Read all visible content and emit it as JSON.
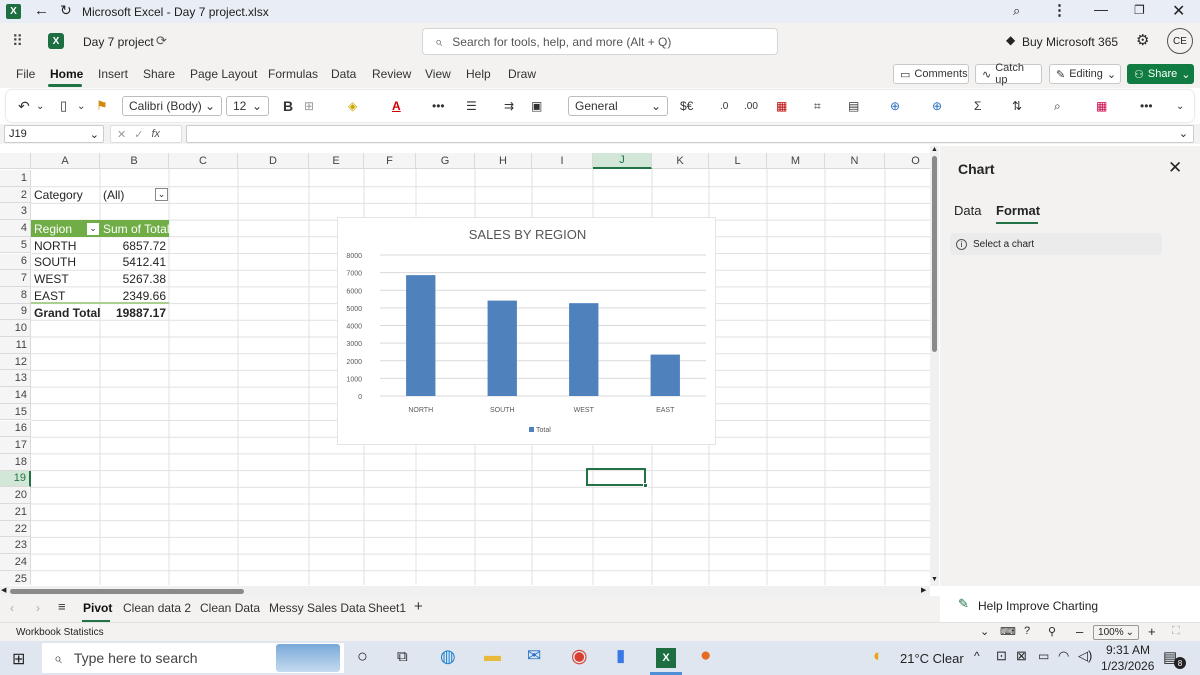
{
  "window": {
    "title": "Microsoft Excel - Day 7 project.xlsx"
  },
  "appbar": {
    "doc_name": "Day 7 project",
    "search_placeholder": "Search for tools, help, and more (Alt + Q)",
    "buy_label": "Buy Microsoft 365",
    "avatar_initials": "CE"
  },
  "ribbon": {
    "tabs": [
      "File",
      "Home",
      "Insert",
      "Share",
      "Page Layout",
      "Formulas",
      "Data",
      "Review",
      "View",
      "Help",
      "Draw"
    ],
    "active_tab": "Home",
    "comments_label": "Comments",
    "catchup_label": "Catch up",
    "editing_label": "Editing",
    "share_label": "Share"
  },
  "toolbar": {
    "font_name": "Calibri (Body)",
    "font_size": "12",
    "number_format": "General"
  },
  "formula_bar": {
    "name_box": "J19",
    "fx": "fx",
    "content": ""
  },
  "grid": {
    "columns": [
      "A",
      "B",
      "C",
      "D",
      "E",
      "F",
      "G",
      "H",
      "I",
      "J",
      "K",
      "L",
      "M",
      "N",
      "O"
    ],
    "rows": [
      "1",
      "2",
      "3",
      "4",
      "5",
      "6",
      "7",
      "8",
      "9",
      "10",
      "11",
      "12",
      "13",
      "14",
      "15",
      "16",
      "17",
      "18",
      "19",
      "20",
      "21",
      "22",
      "23",
      "24",
      "25"
    ],
    "selected_column": "J",
    "selected_row": "19",
    "filter_label": "Category",
    "filter_value": "(All)",
    "pivot_header_region": "Region",
    "pivot_header_sum": "Sum of Total",
    "pivot_rows": [
      {
        "region": "NORTH",
        "value": "6857.72"
      },
      {
        "region": "SOUTH",
        "value": "5412.41"
      },
      {
        "region": "WEST",
        "value": "5267.38"
      },
      {
        "region": "EAST",
        "value": "2349.66"
      }
    ],
    "grand_total_label": "Grand Total",
    "grand_total_value": "19887.17"
  },
  "chart_data": {
    "type": "bar",
    "title": "SALES BY REGION",
    "categories": [
      "NORTH",
      "SOUTH",
      "WEST",
      "EAST"
    ],
    "series": [
      {
        "name": "Total",
        "values": [
          6857.72,
          5412.41,
          5267.38,
          2349.66
        ],
        "color": "#4f81bd"
      }
    ],
    "yticks": [
      "0",
      "1000",
      "2000",
      "3000",
      "4000",
      "5000",
      "6000",
      "7000",
      "8000"
    ],
    "ylim": [
      0,
      8000
    ],
    "grid": true,
    "legend": "bottom"
  },
  "side_panel": {
    "title": "Chart",
    "tab_data": "Data",
    "tab_format": "Format",
    "message": "Select a chart",
    "help_link": "Help Improve Charting"
  },
  "sheets": {
    "tabs": [
      "Pivot",
      "Clean data 2",
      "Clean Data",
      "Messy Sales Data",
      "Sheet1"
    ],
    "active": "Pivot"
  },
  "status": {
    "left": "Workbook Statistics",
    "zoom": "100%"
  },
  "taskbar": {
    "search_placeholder": "Type here to search",
    "weather": "21°C Clear",
    "time": "9:31 AM",
    "date": "1/23/2026",
    "notification_count": "8"
  }
}
